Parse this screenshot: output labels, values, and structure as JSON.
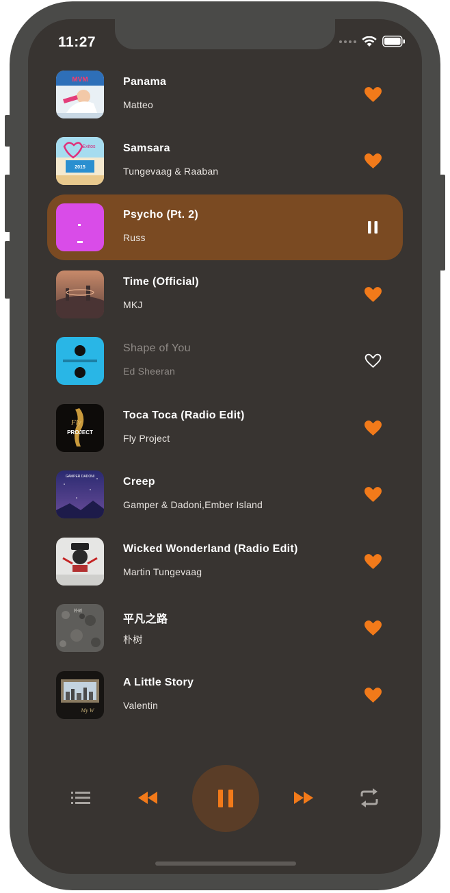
{
  "status_bar": {
    "time": "11:27"
  },
  "colors": {
    "background": "#383431",
    "accent": "#f27a1a",
    "active_row": "#7a4a22",
    "play_button_bg": "#5a3d27"
  },
  "tracks": [
    {
      "title": "Panama",
      "artist": "Matteo",
      "liked": true,
      "state": "normal"
    },
    {
      "title": "Samsara",
      "artist": "Tungevaag & Raaban",
      "liked": true,
      "state": "normal"
    },
    {
      "title": "Psycho (Pt. 2)",
      "artist": "Russ",
      "liked": true,
      "state": "playing"
    },
    {
      "title": "Time (Official)",
      "artist": "MKJ",
      "liked": true,
      "state": "normal"
    },
    {
      "title": "Shape of You",
      "artist": "Ed Sheeran",
      "liked": false,
      "state": "disabled"
    },
    {
      "title": "Toca Toca (Radio Edit)",
      "artist": "Fly Project",
      "liked": true,
      "state": "normal"
    },
    {
      "title": "Creep",
      "artist": "Gamper & Dadoni,Ember Island",
      "liked": true,
      "state": "normal"
    },
    {
      "title": "Wicked Wonderland (Radio Edit)",
      "artist": "Martin Tungevaag",
      "liked": true,
      "state": "normal"
    },
    {
      "title": "平凡之路",
      "artist": "朴树",
      "liked": true,
      "state": "normal"
    },
    {
      "title": "A Little Story",
      "artist": "Valentin",
      "liked": true,
      "state": "normal"
    }
  ],
  "player": {
    "icons": [
      "playlist-icon",
      "rewind-icon",
      "pause-icon",
      "fast-forward-icon",
      "repeat-icon"
    ]
  }
}
